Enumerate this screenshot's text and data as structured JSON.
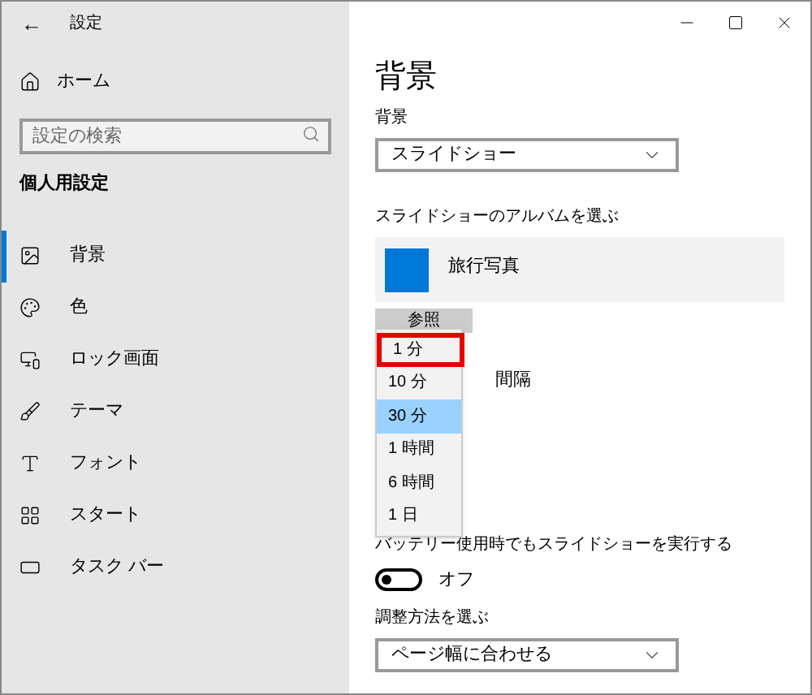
{
  "window": {
    "title": "設定",
    "back": "←"
  },
  "sidebar": {
    "home": "ホーム",
    "search": {
      "placeholder": "設定の検索"
    },
    "section": "個人用設定",
    "items": [
      {
        "label": "背景",
        "kind": "picture",
        "selected": true
      },
      {
        "label": "色",
        "kind": "palette",
        "selected": false
      },
      {
        "label": "ロック画面",
        "kind": "lock",
        "selected": false
      },
      {
        "label": "テーマ",
        "kind": "theme",
        "selected": false
      },
      {
        "label": "フォント",
        "kind": "font",
        "selected": false
      },
      {
        "label": "スタート",
        "kind": "start",
        "selected": false
      },
      {
        "label": "タスク バー",
        "kind": "taskbar",
        "selected": false
      }
    ]
  },
  "main": {
    "heading": "背景",
    "background_label": "背景",
    "background_value": "スライドショー",
    "album_label": "スライドショーのアルバムを選ぶ",
    "album": "旅行写真",
    "browse": "参照",
    "interval_label": "間隔",
    "interval_options": [
      {
        "label": "1 分",
        "selected": false,
        "highlighted": true
      },
      {
        "label": "10 分",
        "selected": false,
        "highlighted": false
      },
      {
        "label": "30 分",
        "selected": true,
        "highlighted": false
      },
      {
        "label": "1 時間",
        "selected": false,
        "highlighted": false
      },
      {
        "label": "6 時間",
        "selected": false,
        "highlighted": false
      },
      {
        "label": "1 日",
        "selected": false,
        "highlighted": false
      }
    ],
    "battery_label": "バッテリー使用時でもスライドショーを実行する",
    "battery_toggle": {
      "on": false,
      "label": "オフ"
    },
    "fit_label": "調整方法を選ぶ",
    "fit_value": "ページ幅に合わせる"
  }
}
